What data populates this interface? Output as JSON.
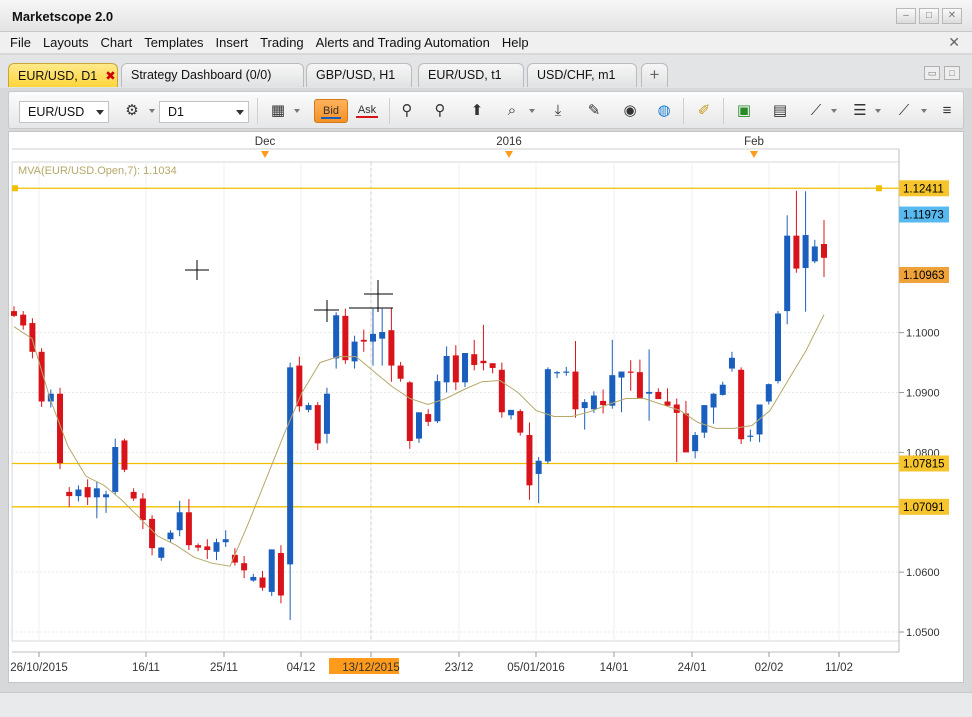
{
  "window": {
    "title": "Marketscope 2.0",
    "minimize": "–",
    "maximize": "□",
    "close": "✕",
    "menu_close": "✕"
  },
  "menu": [
    "File",
    "Layouts",
    "Chart",
    "Templates",
    "Insert",
    "Trading",
    "Alerts and Trading Automation",
    "Help"
  ],
  "tabs": [
    {
      "label": "EUR/USD, D1",
      "active": true,
      "close": "✖"
    },
    {
      "label": "Strategy Dashboard (0/0)"
    },
    {
      "label": "GBP/USD, H1"
    },
    {
      "label": "EUR/USD, t1"
    },
    {
      "label": "USD/CHF, m1"
    }
  ],
  "new_tab": "+",
  "toolbar": {
    "instrument": "EUR/USD",
    "timeframe": "D1",
    "bid_label": "Bid",
    "ask_label": "Ask",
    "icons": [
      "chart-type-icon",
      "search-instrument-icon",
      "add-indicator-icon",
      "zoom-icon",
      "depth-of-market-icon",
      "trade-icon",
      "color-settings-icon",
      "globe-icon",
      "ruler-icon",
      "screenshot-icon",
      "layout-icon",
      "drawing-lines-icon",
      "horizontal-lines-icon",
      "fibonacci-icon",
      "more-icon"
    ],
    "accent": "#f39127"
  },
  "chart": {
    "indicator_label": "MVA(EUR/USD.Open,7): 1.1034",
    "top_markers": [
      "Dec",
      "2016",
      "Feb"
    ],
    "price_labels": [
      {
        "text": "1.12411",
        "style": "gold"
      },
      {
        "text": "1.11973",
        "style": "blue"
      },
      {
        "text": "1.10963",
        "style": "orange"
      },
      {
        "text": "1.07815",
        "style": "gold"
      },
      {
        "text": "1.07091",
        "style": "gold"
      }
    ],
    "highlighted_date": "13/12/2015",
    "colors": {
      "bull": "#1a5fbd",
      "bear": "#d8141a",
      "line": "#f0c000",
      "mva": "#b5a86a",
      "highlight": "#ff9a1a"
    }
  },
  "chart_data": {
    "type": "candlestick",
    "instrument": "EUR/USD",
    "timeframe": "D1",
    "xlabels": [
      "26/10/2015",
      "16/11",
      "25/11",
      "04/12",
      "13/12/2015",
      "23/12",
      "05/01/2016",
      "14/01",
      "24/01",
      "02/02",
      "11/02"
    ],
    "yticks": [
      1.05,
      1.06,
      1.09,
      1.1,
      1.08
    ],
    "ylim": [
      1.0485,
      1.1285
    ],
    "horizontal_lines": [
      1.12411,
      1.07815,
      1.07091
    ],
    "candles": [
      [
        1.1036,
        1.1044,
        1.1026,
        1.1028
      ],
      [
        1.103,
        1.1036,
        1.1005,
        1.1012
      ],
      [
        1.1016,
        1.1024,
        1.0957,
        1.0968
      ],
      [
        1.0968,
        1.0974,
        1.0876,
        1.0885
      ],
      [
        1.0885,
        1.0905,
        1.0875,
        1.0898
      ],
      [
        1.0898,
        1.0908,
        1.0772,
        1.0782
      ],
      [
        1.0734,
        1.0742,
        1.0709,
        1.0727
      ],
      [
        1.0727,
        1.0745,
        1.0718,
        1.0738
      ],
      [
        1.0742,
        1.0755,
        1.0712,
        1.0725
      ],
      [
        1.0725,
        1.0751,
        1.069,
        1.074
      ],
      [
        1.0725,
        1.0736,
        1.0699,
        1.073
      ],
      [
        1.0734,
        1.0823,
        1.0729,
        1.0809
      ],
      [
        1.082,
        1.0823,
        1.0767,
        1.0771
      ],
      [
        1.0734,
        1.074,
        1.0719,
        1.0723
      ],
      [
        1.0723,
        1.0732,
        1.0672,
        1.0687
      ],
      [
        1.0689,
        1.0695,
        1.0628,
        1.064
      ],
      [
        1.0624,
        1.0642,
        1.0619,
        1.0641
      ],
      [
        1.0655,
        1.067,
        1.065,
        1.0666
      ],
      [
        1.067,
        1.0719,
        1.066,
        1.07
      ],
      [
        1.07,
        1.0722,
        1.0637,
        1.0645
      ],
      [
        1.0645,
        1.0648,
        1.0635,
        1.0641
      ],
      [
        1.0643,
        1.0655,
        1.0622,
        1.0637
      ],
      [
        1.0634,
        1.0656,
        1.062,
        1.065
      ],
      [
        1.065,
        1.067,
        1.0642,
        1.0655
      ],
      [
        1.0629,
        1.064,
        1.0611,
        1.0616
      ],
      [
        1.0615,
        1.0627,
        1.059,
        1.0603
      ],
      [
        1.0586,
        1.0597,
        1.0584,
        1.0592
      ],
      [
        1.0591,
        1.0602,
        1.0569,
        1.0574
      ],
      [
        1.0567,
        1.0637,
        1.056,
        1.0638
      ],
      [
        1.0632,
        1.0645,
        1.0548,
        1.0561
      ],
      [
        1.0613,
        1.095,
        1.052,
        1.0942
      ],
      [
        1.0945,
        1.096,
        1.0868,
        1.0877
      ],
      [
        1.0871,
        1.0883,
        1.0867,
        1.0879
      ],
      [
        1.0879,
        1.0884,
        1.0804,
        1.0815
      ],
      [
        1.0831,
        1.0908,
        1.0815,
        1.0898
      ],
      [
        1.0957,
        1.1034,
        1.094,
        1.1029
      ],
      [
        1.1028,
        1.104,
        1.0948,
        1.0954
      ],
      [
        1.0952,
        1.0995,
        1.094,
        1.0985
      ],
      [
        1.0988,
        1.1005,
        1.0968,
        1.0985
      ],
      [
        1.0985,
        1.104,
        1.0945,
        1.0998
      ],
      [
        1.099,
        1.104,
        1.0945,
        1.1001
      ],
      [
        1.1004,
        1.1041,
        1.0918,
        1.0945
      ],
      [
        1.0945,
        1.0951,
        1.0918,
        1.0923
      ],
      [
        1.0917,
        1.0919,
        1.0806,
        1.0819
      ],
      [
        1.0823,
        1.0861,
        1.0816,
        1.0867
      ],
      [
        1.0864,
        1.0872,
        1.0844,
        1.0851
      ],
      [
        1.0852,
        1.093,
        1.0849,
        1.0919
      ],
      [
        1.0917,
        1.0977,
        1.09,
        1.0961
      ],
      [
        1.0962,
        1.0979,
        1.0904,
        1.0917
      ],
      [
        1.0917,
        1.0958,
        1.0909,
        1.0966
      ],
      [
        1.0964,
        1.0988,
        1.0937,
        1.0946
      ],
      [
        1.0953,
        1.1013,
        1.0937,
        1.0949
      ],
      [
        1.0949,
        1.0948,
        1.0932,
        1.0941
      ],
      [
        1.0938,
        1.095,
        1.0858,
        1.0867
      ],
      [
        1.0862,
        1.0871,
        1.0855,
        1.0871
      ],
      [
        1.0869,
        1.0872,
        1.0828,
        1.0833
      ],
      [
        1.0829,
        1.085,
        1.0721,
        1.0745
      ],
      [
        1.0764,
        1.0792,
        1.0715,
        1.0786
      ],
      [
        1.0785,
        1.0942,
        1.0781,
        1.0939
      ],
      [
        1.0933,
        1.0936,
        1.0924,
        1.0934
      ],
      [
        1.0933,
        1.0943,
        1.0928,
        1.0935
      ],
      [
        1.0935,
        1.0986,
        1.0858,
        1.0872
      ],
      [
        1.0874,
        1.0889,
        1.0838,
        1.0884
      ],
      [
        1.0872,
        1.0902,
        1.0866,
        1.0895
      ],
      [
        1.0886,
        1.0905,
        1.0865,
        1.0879
      ],
      [
        1.0878,
        1.0988,
        1.0873,
        1.0929
      ],
      [
        1.0925,
        1.0934,
        1.0867,
        1.0935
      ],
      [
        1.0935,
        1.0954,
        1.0903,
        1.0934
      ],
      [
        1.0934,
        1.0955,
        1.0896,
        1.0891
      ],
      [
        1.0898,
        1.0972,
        1.0853,
        1.0901
      ],
      [
        1.0901,
        1.0907,
        1.0892,
        1.0889
      ],
      [
        1.0885,
        1.0907,
        1.0877,
        1.0878
      ],
      [
        1.088,
        1.089,
        1.0784,
        1.0866
      ],
      [
        1.0865,
        1.0886,
        1.0842,
        1.08
      ],
      [
        1.0802,
        1.0834,
        1.079,
        1.0829
      ],
      [
        1.0833,
        1.0864,
        1.0824,
        1.0879
      ],
      [
        1.0875,
        1.0899,
        1.0848,
        1.0898
      ],
      [
        1.0896,
        1.0918,
        1.0895,
        1.0913
      ],
      [
        1.094,
        1.0968,
        1.0935,
        1.0958
      ],
      [
        1.0938,
        1.0942,
        1.0814,
        1.0822
      ],
      [
        1.0826,
        1.0838,
        1.0818,
        1.0828
      ],
      [
        1.083,
        1.087,
        1.0817,
        1.088
      ],
      [
        1.0885,
        1.0915,
        1.088,
        1.0914
      ],
      [
        1.0919,
        1.1036,
        1.0915,
        1.1032
      ],
      [
        1.1036,
        1.1196,
        1.1014,
        1.1162
      ],
      [
        1.1162,
        1.1237,
        1.11,
        1.1107
      ],
      [
        1.1108,
        1.1236,
        1.1035,
        1.1163
      ],
      [
        1.1119,
        1.1155,
        1.1116,
        1.1144
      ],
      [
        1.1148,
        1.1188,
        1.1093,
        1.1125
      ]
    ],
    "mva": [
      [
        0,
        1.101
      ],
      [
        5,
        1.099
      ],
      [
        10,
        1.089
      ],
      [
        15,
        1.081
      ],
      [
        20,
        1.076
      ],
      [
        25,
        1.0745
      ],
      [
        30,
        1.072
      ],
      [
        35,
        1.069
      ],
      [
        40,
        1.066
      ],
      [
        45,
        1.0645
      ],
      [
        50,
        1.0625
      ],
      [
        55,
        1.0615
      ],
      [
        60,
        1.061
      ],
      [
        65,
        1.068
      ],
      [
        70,
        1.0755
      ],
      [
        75,
        1.083
      ],
      [
        80,
        1.09
      ],
      [
        85,
        1.095
      ],
      [
        90,
        1.096
      ],
      [
        95,
        1.096
      ],
      [
        100,
        1.0935
      ],
      [
        105,
        1.091
      ],
      [
        110,
        1.089
      ],
      [
        115,
        1.088
      ],
      [
        120,
        1.089
      ],
      [
        125,
        1.0905
      ],
      [
        130,
        1.0918
      ],
      [
        135,
        1.092
      ],
      [
        140,
        1.09
      ],
      [
        145,
        1.087
      ],
      [
        150,
        1.086
      ],
      [
        155,
        1.086
      ],
      [
        160,
        1.0868
      ],
      [
        165,
        1.088
      ],
      [
        170,
        1.089
      ],
      [
        175,
        1.089
      ],
      [
        180,
        1.088
      ],
      [
        185,
        1.087
      ],
      [
        190,
        1.085
      ],
      [
        195,
        1.084
      ],
      [
        200,
        1.084
      ],
      [
        205,
        1.0845
      ],
      [
        210,
        1.087
      ],
      [
        215,
        1.092
      ],
      [
        220,
        1.097
      ],
      [
        225,
        1.103
      ]
    ]
  }
}
